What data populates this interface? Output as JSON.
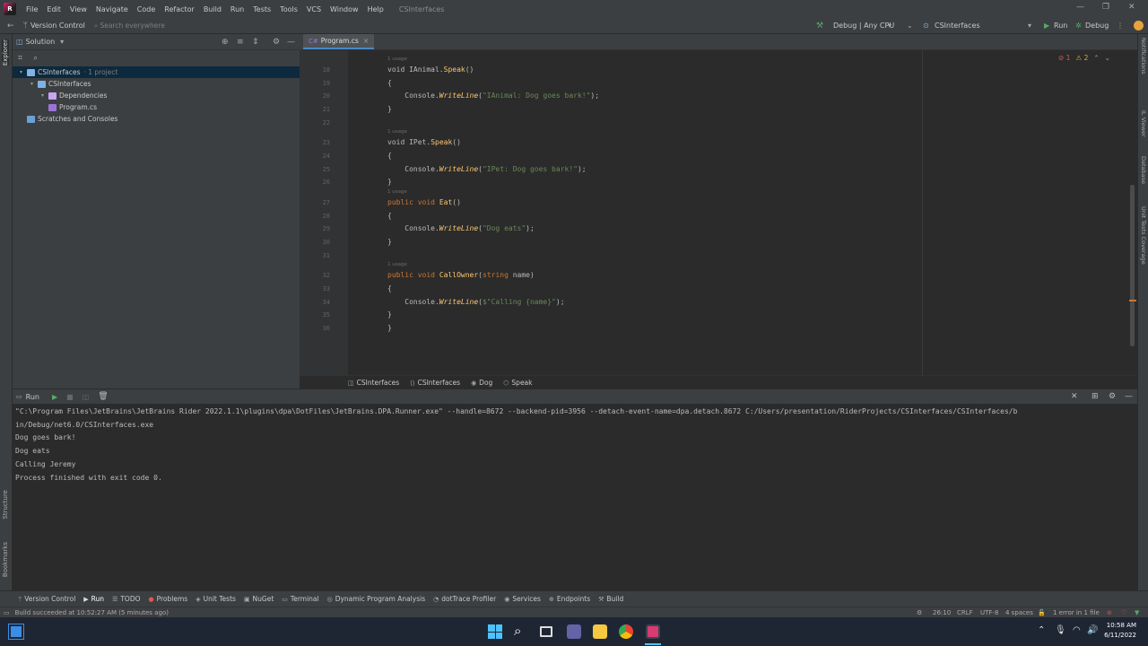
{
  "menu": [
    "File",
    "Edit",
    "View",
    "Navigate",
    "Code",
    "Refactor",
    "Build",
    "Run",
    "Tests",
    "Tools",
    "VCS",
    "Window",
    "Help"
  ],
  "window_title": "CSInterfaces",
  "toolbar": {
    "version_control": "Version Control",
    "search_placeholder": "Search everywhere",
    "config": "Debug | Any CPU",
    "project": "CSInterfaces",
    "run_label": "Run",
    "debug_label": "Debug"
  },
  "explorer": {
    "title": "Solution",
    "tree": [
      {
        "label": "CSInterfaces",
        "extra": "· 1 project",
        "depth": 0,
        "selected": true,
        "icon": "solution-icon"
      },
      {
        "label": "CSInterfaces",
        "extra": "",
        "depth": 1,
        "selected": false,
        "icon": "project-icon"
      },
      {
        "label": "Dependencies",
        "extra": "",
        "depth": 2,
        "selected": false,
        "icon": "dependencies-icon"
      },
      {
        "label": "Program.cs",
        "extra": "",
        "depth": 2,
        "selected": false,
        "icon": "csharp-file-icon"
      },
      {
        "label": "Scratches and Consoles",
        "extra": "",
        "depth": 0,
        "selected": false,
        "icon": "scratches-icon"
      }
    ]
  },
  "stripes": {
    "left_top": "Explorer",
    "left_structure": "Structure",
    "left_bookmarks": "Bookmarks",
    "right": [
      "Notifications",
      "IL Viewer",
      "Database",
      "Unit Tests Coverage"
    ]
  },
  "editor": {
    "tab": "Program.cs",
    "inspections": {
      "errors": "1",
      "warnings": "2"
    },
    "usage_hint": "1 usage",
    "lines": [
      {
        "n": "18",
        "kind": "usage"
      },
      {
        "n": "18",
        "kind": "code",
        "tokens": [
          [
            "plain",
            "void "
          ],
          [
            "plain",
            "IAnimal."
          ],
          [
            "fn",
            "Speak"
          ],
          [
            "plain",
            "()"
          ]
        ]
      },
      {
        "n": "19",
        "kind": "code",
        "tokens": [
          [
            "plain",
            "{"
          ]
        ]
      },
      {
        "n": "20",
        "kind": "code",
        "tokens": [
          [
            "plain",
            "    Console."
          ],
          [
            "mth",
            "WriteLine"
          ],
          [
            "plain",
            "("
          ],
          [
            "str",
            "\"IAnimal: Dog goes bark!\""
          ],
          [
            "plain",
            ");"
          ]
        ]
      },
      {
        "n": "21",
        "kind": "code",
        "tokens": [
          [
            "plain",
            "}"
          ]
        ]
      },
      {
        "n": "22",
        "kind": "code",
        "tokens": []
      },
      {
        "n": "",
        "kind": "usage"
      },
      {
        "n": "23",
        "kind": "code",
        "tokens": [
          [
            "plain",
            "void "
          ],
          [
            "plain",
            "IPet."
          ],
          [
            "fn",
            "Speak"
          ],
          [
            "plain",
            "()"
          ]
        ]
      },
      {
        "n": "24",
        "kind": "code",
        "tokens": [
          [
            "plain",
            "{"
          ]
        ]
      },
      {
        "n": "25",
        "kind": "code",
        "tokens": [
          [
            "plain",
            "    Console."
          ],
          [
            "mth",
            "WriteLine"
          ],
          [
            "plain",
            "("
          ],
          [
            "str",
            "\"IPet: Dog goes bark!\""
          ],
          [
            "plain",
            ");"
          ]
        ]
      },
      {
        "n": "26",
        "kind": "code",
        "tokens": [
          [
            "plain",
            "}"
          ]
        ]
      },
      {
        "n": "",
        "kind": "usage"
      },
      {
        "n": "27",
        "kind": "code",
        "tokens": [
          [
            "kw",
            "public "
          ],
          [
            "kw",
            "void "
          ],
          [
            "fn",
            "Eat"
          ],
          [
            "plain",
            "()"
          ]
        ]
      },
      {
        "n": "28",
        "kind": "code",
        "tokens": [
          [
            "plain",
            "{"
          ]
        ]
      },
      {
        "n": "29",
        "kind": "code",
        "tokens": [
          [
            "plain",
            "    Console."
          ],
          [
            "mth",
            "WriteLine"
          ],
          [
            "plain",
            "("
          ],
          [
            "str",
            "\"Dog eats\""
          ],
          [
            "plain",
            ");"
          ]
        ]
      },
      {
        "n": "30",
        "kind": "code",
        "tokens": [
          [
            "plain",
            "}"
          ]
        ]
      },
      {
        "n": "31",
        "kind": "code",
        "tokens": []
      },
      {
        "n": "",
        "kind": "usage"
      },
      {
        "n": "32",
        "kind": "code",
        "tokens": [
          [
            "kw",
            "public "
          ],
          [
            "kw",
            "void "
          ],
          [
            "fn",
            "CallOwner"
          ],
          [
            "plain",
            "("
          ],
          [
            "kw",
            "string "
          ],
          [
            "plain",
            "name)"
          ]
        ]
      },
      {
        "n": "33",
        "kind": "code",
        "tokens": [
          [
            "plain",
            "{"
          ]
        ]
      },
      {
        "n": "34",
        "kind": "code",
        "tokens": [
          [
            "plain",
            "    Console."
          ],
          [
            "mth",
            "WriteLine"
          ],
          [
            "plain",
            "("
          ],
          [
            "str",
            "$\"Calling {name}\""
          ],
          [
            "plain",
            ");"
          ]
        ]
      },
      {
        "n": "35",
        "kind": "code",
        "tokens": [
          [
            "plain",
            "}"
          ]
        ]
      },
      {
        "n": "36",
        "kind": "code",
        "tokens": [
          [
            "plain",
            "}"
          ]
        ]
      }
    ],
    "breadcrumb": [
      "CSInterfaces",
      "CSInterfaces",
      "Dog",
      "Speak"
    ]
  },
  "run": {
    "title": "Run",
    "output": [
      "\"C:\\Program Files\\JetBrains\\JetBrains Rider 2022.1.1\\plugins\\dpa\\DotFiles\\JetBrains.DPA.Runner.exe\" --handle=8672 --backend-pid=3956 --detach-event-name=dpa.detach.8672 C:/Users/presentation/RiderProjects/CSInterfaces/CSInterfaces/b",
      "in/Debug/net6.0/CSInterfaces.exe",
      "Dog goes bark!",
      "Dog eats",
      "Calling Jeremy",
      "",
      "Process finished with exit code 0."
    ]
  },
  "bottom_tools": [
    {
      "label": "Version Control",
      "icon": "version-control-icon",
      "active": false
    },
    {
      "label": "Run",
      "icon": "run-icon",
      "active": true
    },
    {
      "label": "TODO",
      "icon": "todo-icon",
      "active": false
    },
    {
      "label": "Problems",
      "icon": "problems-icon",
      "active": false
    },
    {
      "label": "Unit Tests",
      "icon": "unit-tests-icon",
      "active": false
    },
    {
      "label": "NuGet",
      "icon": "nuget-icon",
      "active": false
    },
    {
      "label": "Terminal",
      "icon": "terminal-icon",
      "active": false
    },
    {
      "label": "Dynamic Program Analysis",
      "icon": "dpa-icon",
      "active": false
    },
    {
      "label": "dotTrace Profiler",
      "icon": "profiler-icon",
      "active": false
    },
    {
      "label": "Services",
      "icon": "services-icon",
      "active": false
    },
    {
      "label": "Endpoints",
      "icon": "endpoints-icon",
      "active": false
    },
    {
      "label": "Build",
      "icon": "build-icon",
      "active": false
    }
  ],
  "status": {
    "message": "Build succeeded at 10:52:27 AM (5 minutes ago)",
    "position": "26:10",
    "line_sep": "CRLF",
    "encoding": "UTF-8",
    "indent": "4 spaces",
    "errors": "1 error in 1 file"
  },
  "taskbar": {
    "time": "10:58 AM",
    "date": "6/11/2022"
  },
  "colors": {
    "accent": "#4a88c7",
    "run_green": "#59a869",
    "error_red": "#e05555"
  }
}
